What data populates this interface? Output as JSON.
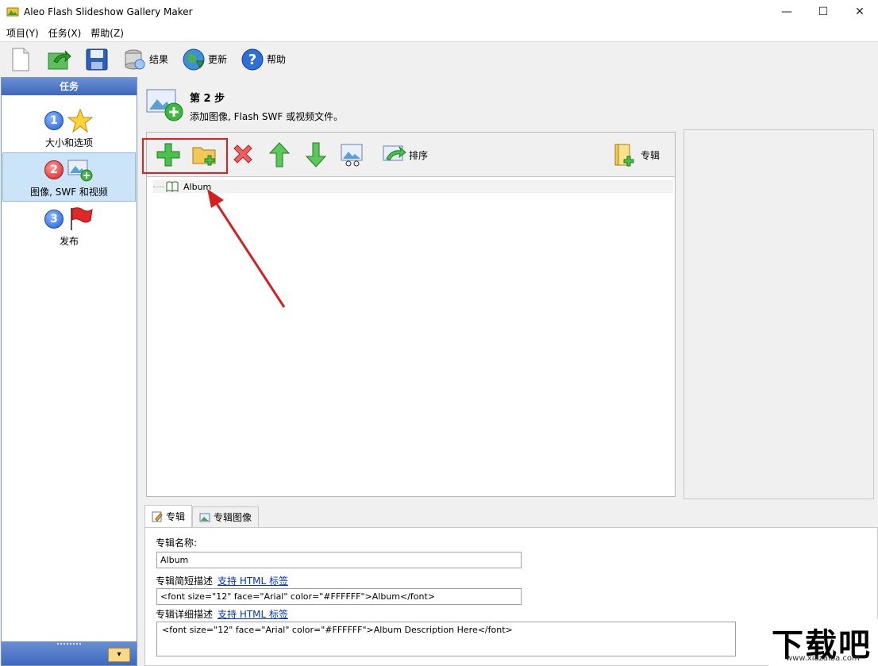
{
  "window": {
    "title": "Aleo Flash Slideshow Gallery Maker",
    "minimize": "—",
    "maximize": "☐",
    "close": "✕"
  },
  "menu": {
    "project": "项目(Y)",
    "task": "任务(X)",
    "help": "帮助(Z)"
  },
  "toolbar": {
    "new_icon": "new-document-icon",
    "open_icon": "open-project-icon",
    "save_icon": "save-disk-icon",
    "results": "结果",
    "update": "更新",
    "help": "帮助"
  },
  "sidebar": {
    "header": "任务",
    "steps": [
      {
        "num": "1",
        "label": "大小和选项",
        "icon": "star-icon"
      },
      {
        "num": "2",
        "label": "图像, SWF 和视频",
        "icon": "add-image-icon",
        "active": true
      },
      {
        "num": "3",
        "label": "发布",
        "icon": "flag-icon"
      }
    ]
  },
  "step_header": {
    "title": "第 2 步",
    "description": "添加图像, Flash SWF 或视频文件。"
  },
  "tree_toolbar": {
    "add_icon": "add-plus-icon",
    "add_folder_icon": "add-folder-icon",
    "delete_icon": "delete-x-icon",
    "move_up_icon": "arrow-up-icon",
    "move_down_icon": "arrow-down-icon",
    "edit_icon": "edit-image-icon",
    "sort": "排序",
    "album": "专辑"
  },
  "tree": {
    "items": [
      {
        "label": "Album"
      }
    ]
  },
  "tabs": [
    {
      "label": "专辑",
      "active": true
    },
    {
      "label": "专辑图像",
      "active": false
    }
  ],
  "album_form": {
    "name_label": "专辑名称:",
    "name_value": "Album",
    "short_desc_label": "专辑简短描述",
    "short_desc_link": "支持 HTML 标签",
    "short_desc_value": "<font size=\"12\" face=\"Arial\" color=\"#FFFFFF\">Album</font>",
    "long_desc_label": "专辑详细描述",
    "long_desc_link": "支持 HTML 标签",
    "long_desc_value": "<font size=\"12\" face=\"Arial\" color=\"#FFFFFF\">Album Description Here</font>"
  },
  "watermark": {
    "brand": "下载吧",
    "domain": "www.xiazaiba.com"
  },
  "colors": {
    "sidebar_header": "#3d69be",
    "active_step": "#cce4f7",
    "highlight": "#e02020",
    "link": "#0033cc"
  }
}
